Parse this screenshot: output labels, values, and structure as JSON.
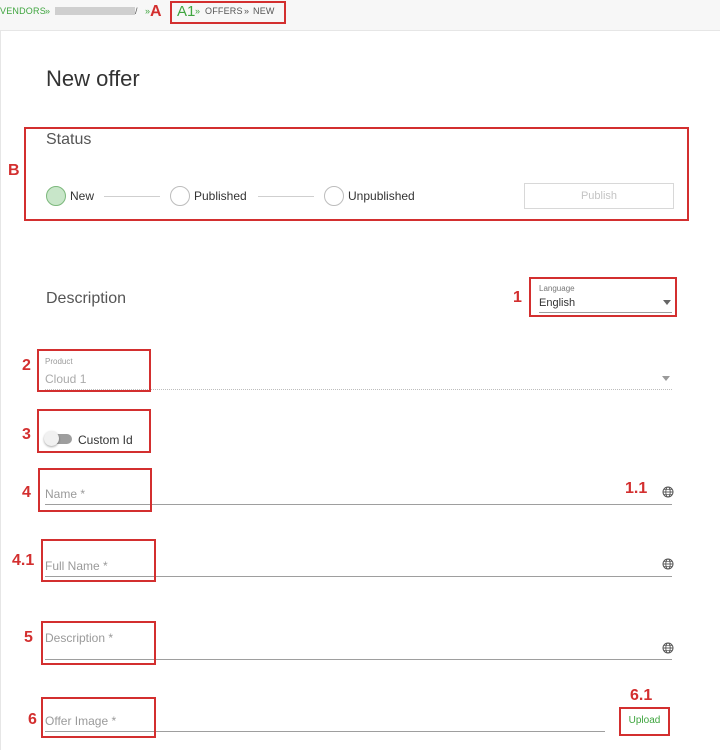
{
  "breadcrumb": {
    "vendors": "VENDORS",
    "sep1": "»",
    "sep2": "»",
    "current_suffix": "/",
    "offers": "OFFERS",
    "sep3": "»",
    "sep4": "»",
    "new": "NEW"
  },
  "page": {
    "title": "New offer"
  },
  "status": {
    "title": "Status",
    "steps": [
      {
        "label": "New",
        "active": true
      },
      {
        "label": "Published",
        "active": false
      },
      {
        "label": "Unpublished",
        "active": false
      }
    ],
    "publish_button": "Publish"
  },
  "description": {
    "title": "Description",
    "language_label": "Language",
    "language_value": "English",
    "product_label": "Product",
    "product_value": "Cloud 1",
    "custom_id_label": "Custom Id",
    "name_placeholder": "Name *",
    "full_name_placeholder": "Full Name *",
    "description_placeholder": "Description *",
    "offer_image_placeholder": "Offer Image *",
    "upload_button": "Upload"
  },
  "annotations": {
    "A": "A",
    "A1": "A1",
    "B": "B",
    "n1": "1",
    "n11": "1.1",
    "n2": "2",
    "n3": "3",
    "n4": "4",
    "n41": "4.1",
    "n5": "5",
    "n6": "6",
    "n61": "6.1"
  },
  "colors": {
    "accent_green": "#3fa53f",
    "annotation_red": "#d32f2f",
    "active_step": "#c8e6c9"
  },
  "icons": [
    "globe-icon",
    "dropdown-caret-icon"
  ]
}
